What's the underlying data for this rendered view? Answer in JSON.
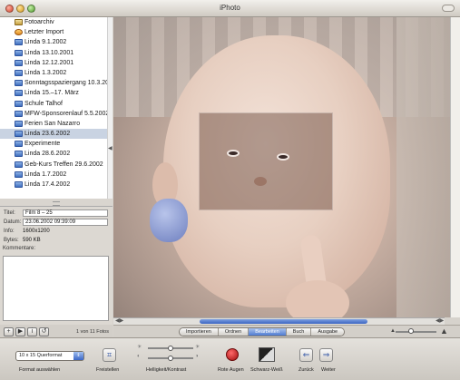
{
  "window": {
    "title": "iPhoto"
  },
  "sidebar": {
    "albums": [
      {
        "label": "Fotoarchiv",
        "kind": "library"
      },
      {
        "label": "Letzter Import",
        "kind": "recent"
      },
      {
        "label": "Linda 9.1.2002",
        "kind": "album"
      },
      {
        "label": "Linda 13.10.2001",
        "kind": "album"
      },
      {
        "label": "Linda 12.12.2001",
        "kind": "album"
      },
      {
        "label": "Linda 1.3.2002",
        "kind": "album"
      },
      {
        "label": "Sonntagsspaziergang 10.3.20",
        "kind": "album"
      },
      {
        "label": "Linda 15.–17. März",
        "kind": "album"
      },
      {
        "label": "Schule Talhof",
        "kind": "album"
      },
      {
        "label": "MFW-Sponsorenlauf 5.5.2002",
        "kind": "album"
      },
      {
        "label": "Ferien San Nazarro",
        "kind": "album"
      },
      {
        "label": "Linda 23.6.2002",
        "kind": "album",
        "selected": true
      },
      {
        "label": "Experimente",
        "kind": "album"
      },
      {
        "label": "Linda 28.6.2002",
        "kind": "album"
      },
      {
        "label": "Geb-Kurs Treffen 29.6.2002",
        "kind": "album"
      },
      {
        "label": "Linda 1.7.2002",
        "kind": "album"
      },
      {
        "label": "Linda 17.4.2002",
        "kind": "album"
      }
    ]
  },
  "info": {
    "title_label": "Titel:",
    "title_value": "Film 8 – 25",
    "date_label": "Datum:",
    "date_value": "23.06.2002 09:39:09",
    "info_label": "Info:",
    "info_value": "1600x1200",
    "bytes_label": "Bytes:",
    "bytes_value": "590 KB",
    "comments_label": "Kommentare:"
  },
  "leftbar": {
    "add_label": "+",
    "play_label": "▶",
    "info_label": "i",
    "rotate_label": "↺",
    "count": "1 von 11 Fotos"
  },
  "modes": [
    {
      "label": "Importieren",
      "active": false
    },
    {
      "label": "Ordnen",
      "active": false
    },
    {
      "label": "Bearbeiten",
      "active": true
    },
    {
      "label": "Buch",
      "active": false
    },
    {
      "label": "Ausgabe",
      "active": false
    }
  ],
  "edit": {
    "format_value": "10 x 15 Querformat",
    "format_label": "Format auswählen",
    "crop_label": "Freistellen",
    "brightness_label": "Helligkeit/Kontrast",
    "redeye_label": "Rote Augen",
    "bw_label": "Schwarz-Weiß",
    "back_label": "Zurück",
    "forward_label": "Weiter",
    "brightness_value": 0.5,
    "contrast_value": 0.5
  }
}
